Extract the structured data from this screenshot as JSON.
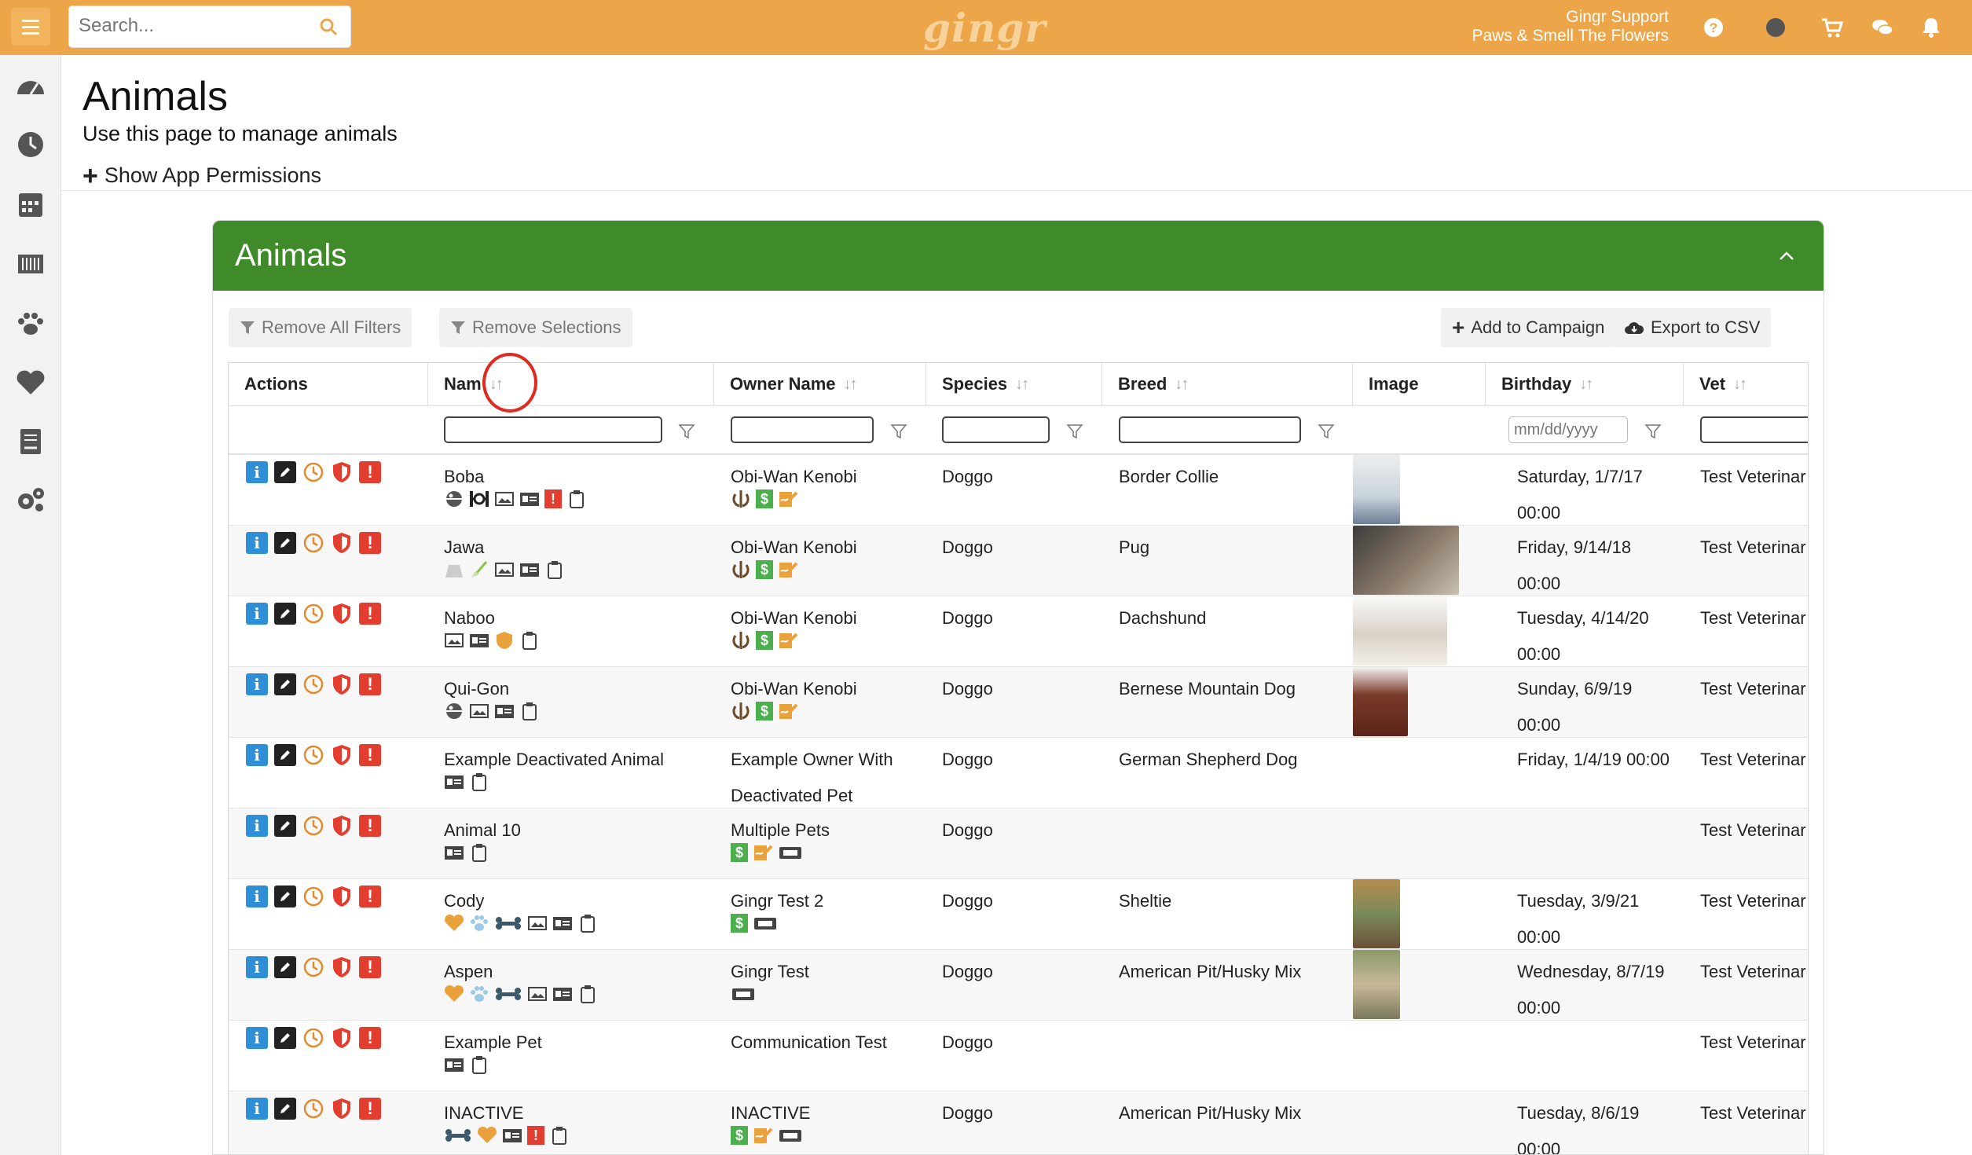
{
  "topbar": {
    "search_placeholder": "Search...",
    "logo": "gingr",
    "account_user": "Gingr Support",
    "account_location": "Paws & Smell The Flowers"
  },
  "colors": {
    "topbar": "#eda54a",
    "card_header": "#3f8a29",
    "info_blue": "#2e8ed6",
    "action_orange": "#e38a2c",
    "alert_red": "#e23d2e",
    "tag_green": "#4cae4c"
  },
  "page": {
    "title": "Animals",
    "subtitle": "Use this page to manage animals",
    "permissions_label": "Show App Permissions"
  },
  "card": {
    "title": "Animals",
    "remove_filters": "Remove All Filters",
    "remove_selections": "Remove Selections",
    "add_campaign": "Add to Campaign",
    "export_csv": "Export to CSV"
  },
  "table": {
    "columns": {
      "actions": "Actions",
      "name": "Nam",
      "owner": "Owner Name",
      "species": "Species",
      "breed": "Breed",
      "image": "Image",
      "birthday": "Birthday",
      "vet": "Vet"
    },
    "birthday_placeholder": "mm/dd/yyyy",
    "rows": [
      {
        "name": "Boba",
        "owner": "Obi-Wan Kenobi",
        "owner2": "",
        "species": "Doggo",
        "breed": "Border Collie",
        "bday1": "Saturday, 1/7/17",
        "bday2": "00:00",
        "vet": "Test Veterinar"
      },
      {
        "name": "Jawa",
        "owner": "Obi-Wan Kenobi",
        "owner2": "",
        "species": "Doggo",
        "breed": "Pug",
        "bday1": "Friday, 9/14/18",
        "bday2": "00:00",
        "vet": "Test Veterinar"
      },
      {
        "name": "Naboo",
        "owner": "Obi-Wan Kenobi",
        "owner2": "",
        "species": "Doggo",
        "breed": "Dachshund",
        "bday1": "Tuesday, 4/14/20",
        "bday2": "00:00",
        "vet": "Test Veterinar"
      },
      {
        "name": "Qui-Gon",
        "owner": "Obi-Wan Kenobi",
        "owner2": "",
        "species": "Doggo",
        "breed": "Bernese Mountain Dog",
        "bday1": "Sunday, 6/9/19",
        "bday2": "00:00",
        "vet": "Test Veterinar"
      },
      {
        "name": "Example Deactivated Animal",
        "owner": "Example Owner With",
        "owner2": "Deactivated Pet",
        "species": "Doggo",
        "breed": "German Shepherd Dog",
        "bday1": "Friday, 1/4/19 00:00",
        "bday2": "",
        "vet": "Test Veterinar"
      },
      {
        "name": "Animal 10",
        "owner": "Multiple Pets",
        "owner2": "",
        "species": "Doggo",
        "breed": "",
        "bday1": "",
        "bday2": "",
        "vet": "Test Veterinar"
      },
      {
        "name": "Cody",
        "owner": "Gingr Test 2",
        "owner2": "",
        "species": "Doggo",
        "breed": "Sheltie",
        "bday1": "Tuesday, 3/9/21",
        "bday2": "00:00",
        "vet": "Test Veterinar"
      },
      {
        "name": "Aspen",
        "owner": "Gingr Test",
        "owner2": "",
        "species": "Doggo",
        "breed": "American Pit/Husky Mix",
        "bday1": "Wednesday, 8/7/19",
        "bday2": "00:00",
        "vet": "Test Veterinar"
      },
      {
        "name": "Example Pet",
        "owner": "Communication Test",
        "owner2": "",
        "species": "Doggo",
        "breed": "",
        "bday1": "",
        "bday2": "",
        "vet": "Test Veterinar"
      },
      {
        "name": "INACTIVE",
        "owner": "INACTIVE",
        "owner2": "",
        "species": "Doggo",
        "breed": "American Pit/Husky Mix",
        "bday1": "Tuesday, 8/6/19",
        "bday2": "00:00",
        "vet": "Test Veterinar"
      }
    ]
  }
}
